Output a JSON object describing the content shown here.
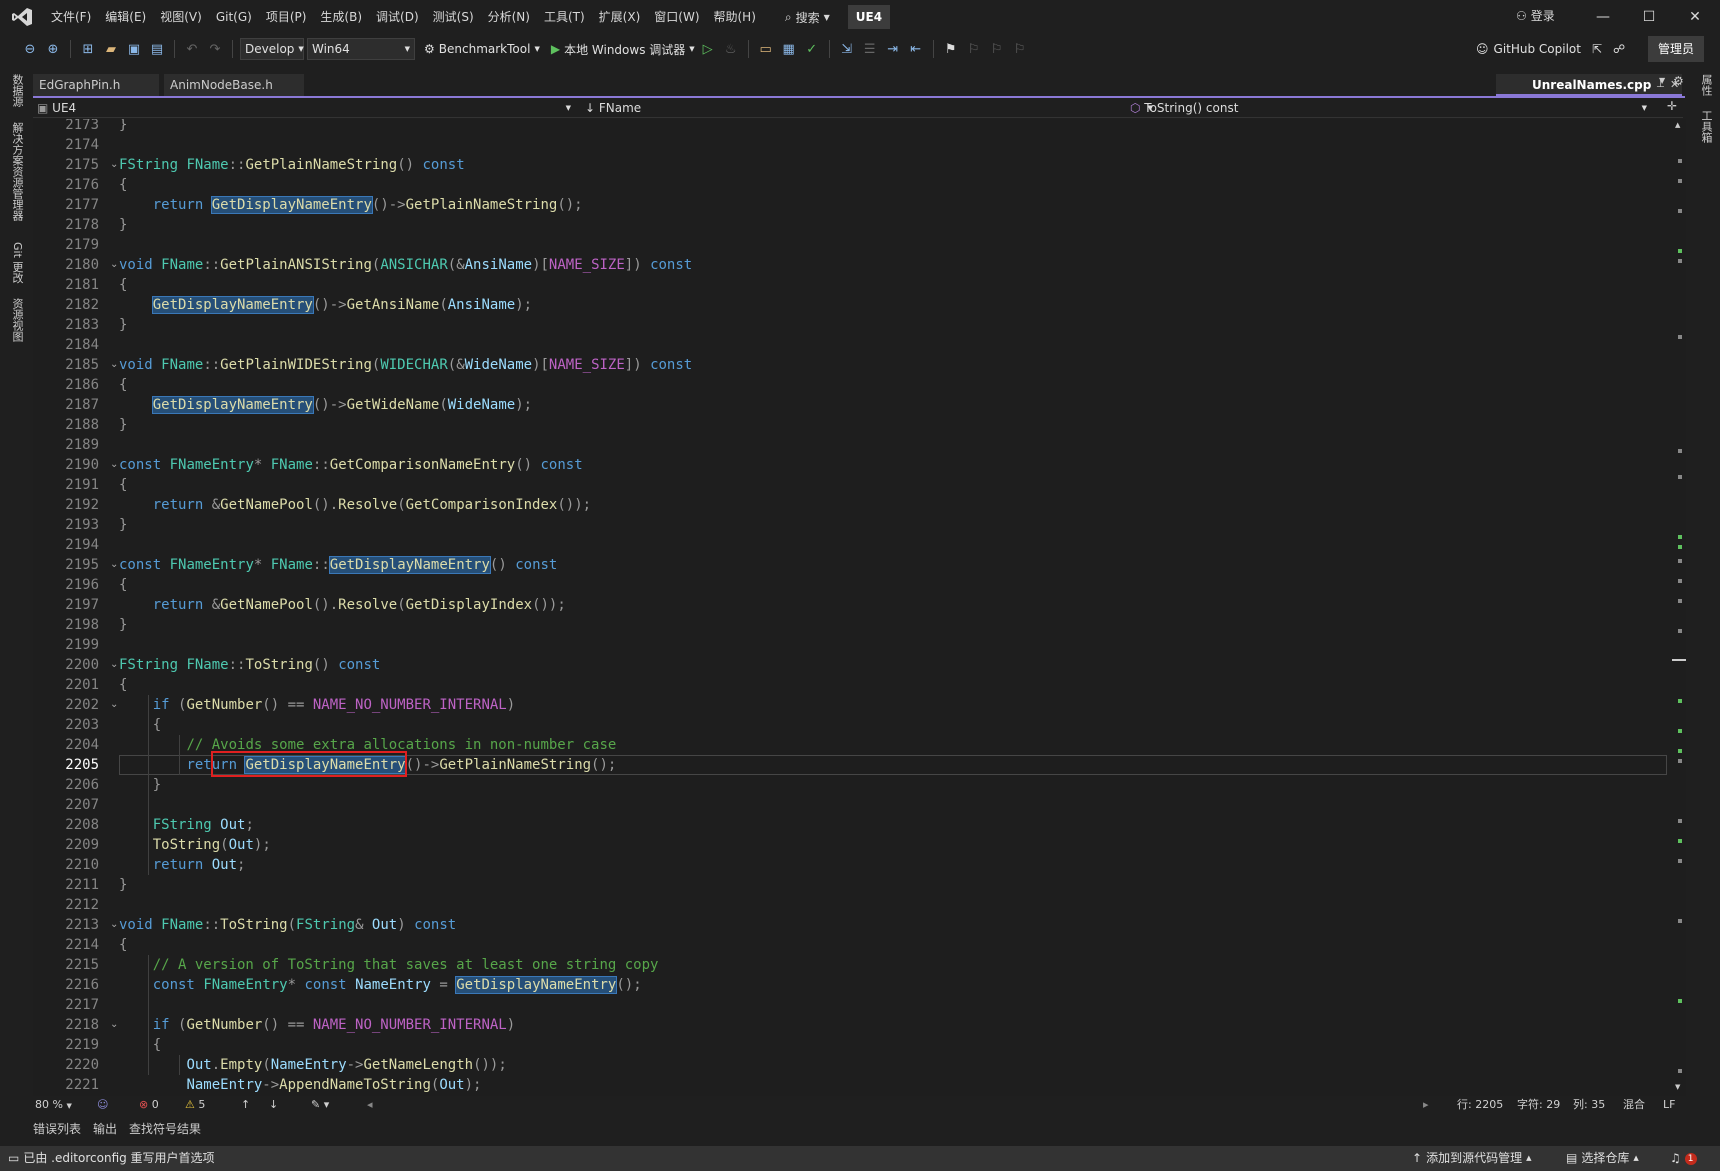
{
  "menubar": {
    "items": [
      "文件(F)",
      "编辑(E)",
      "视图(V)",
      "Git(G)",
      "项目(P)",
      "生成(B)",
      "调试(D)",
      "测试(S)",
      "分析(N)",
      "工具(T)",
      "扩展(X)",
      "窗口(W)",
      "帮助(H)"
    ],
    "search_label": "搜索",
    "solution_name": "UE4",
    "signin_label": "登录"
  },
  "toolbar": {
    "configuration": "Develop",
    "platform": "Win64",
    "startup_project": "BenchmarkTool",
    "debugger_label": "本地 Windows 调试器",
    "copilot_label": "GitHub Copilot",
    "admin_label": "管理员"
  },
  "left_tool_tabs": [
    "数据源",
    "解决方案资源管理器",
    "Git 更改",
    "资源视图"
  ],
  "right_tool_tabs": [
    "属性",
    "工具箱"
  ],
  "doc_tabs": {
    "inactive": [
      "EdGraphPin.h",
      "AnimNodeBase.h"
    ],
    "active": "UnrealNames.cpp"
  },
  "navbar": {
    "project": "UE4",
    "scope": "FName",
    "member": "ToString() const"
  },
  "editor": {
    "current_line": 2205,
    "first_line": 2173,
    "lines": [
      [
        [
          "p",
          "}"
        ]
      ],
      [],
      [
        [
          "t",
          "FString"
        ],
        [
          "p",
          " "
        ],
        [
          "t",
          "FName"
        ],
        [
          "p",
          "::"
        ],
        [
          "f",
          "GetPlainNameString"
        ],
        [
          "p",
          "() "
        ],
        [
          "k",
          "const"
        ]
      ],
      [
        [
          "p",
          "{"
        ]
      ],
      [
        [
          "p",
          "    "
        ],
        [
          "k",
          "return"
        ],
        [
          "p",
          " "
        ],
        [
          "hl",
          "GetDisplayNameEntry"
        ],
        [
          "p",
          "()->"
        ],
        [
          "f",
          "GetPlainNameString"
        ],
        [
          "p",
          "();"
        ]
      ],
      [
        [
          "p",
          "}"
        ]
      ],
      [],
      [
        [
          "k",
          "void"
        ],
        [
          "p",
          " "
        ],
        [
          "t",
          "FName"
        ],
        [
          "p",
          "::"
        ],
        [
          "f",
          "GetPlainANSIString"
        ],
        [
          "p",
          "("
        ],
        [
          "t",
          "ANSICHAR"
        ],
        [
          "p",
          "(&"
        ],
        [
          "v",
          "AnsiName"
        ],
        [
          "p",
          ")["
        ],
        [
          "m",
          "NAME_SIZE"
        ],
        [
          "p",
          "]) "
        ],
        [
          "k",
          "const"
        ]
      ],
      [
        [
          "p",
          "{"
        ]
      ],
      [
        [
          "p",
          "    "
        ],
        [
          "hl",
          "GetDisplayNameEntry"
        ],
        [
          "p",
          "()->"
        ],
        [
          "f",
          "GetAnsiName"
        ],
        [
          "p",
          "("
        ],
        [
          "v",
          "AnsiName"
        ],
        [
          "p",
          ");"
        ]
      ],
      [
        [
          "p",
          "}"
        ]
      ],
      [],
      [
        [
          "k",
          "void"
        ],
        [
          "p",
          " "
        ],
        [
          "t",
          "FName"
        ],
        [
          "p",
          "::"
        ],
        [
          "f",
          "GetPlainWIDEString"
        ],
        [
          "p",
          "("
        ],
        [
          "t",
          "WIDECHAR"
        ],
        [
          "p",
          "(&"
        ],
        [
          "v",
          "WideName"
        ],
        [
          "p",
          ")["
        ],
        [
          "m",
          "NAME_SIZE"
        ],
        [
          "p",
          "]) "
        ],
        [
          "k",
          "const"
        ]
      ],
      [
        [
          "p",
          "{"
        ]
      ],
      [
        [
          "p",
          "    "
        ],
        [
          "hl",
          "GetDisplayNameEntry"
        ],
        [
          "p",
          "()->"
        ],
        [
          "f",
          "GetWideName"
        ],
        [
          "p",
          "("
        ],
        [
          "v",
          "WideName"
        ],
        [
          "p",
          ");"
        ]
      ],
      [
        [
          "p",
          "}"
        ]
      ],
      [],
      [
        [
          "k",
          "const"
        ],
        [
          "p",
          " "
        ],
        [
          "t",
          "FNameEntry"
        ],
        [
          "p",
          "* "
        ],
        [
          "t",
          "FName"
        ],
        [
          "p",
          "::"
        ],
        [
          "f",
          "GetComparisonNameEntry"
        ],
        [
          "p",
          "() "
        ],
        [
          "k",
          "const"
        ]
      ],
      [
        [
          "p",
          "{"
        ]
      ],
      [
        [
          "p",
          "    "
        ],
        [
          "k",
          "return"
        ],
        [
          "p",
          " &"
        ],
        [
          "f",
          "GetNamePool"
        ],
        [
          "p",
          "()."
        ],
        [
          "f",
          "Resolve"
        ],
        [
          "p",
          "("
        ],
        [
          "f",
          "GetComparisonIndex"
        ],
        [
          "p",
          "());"
        ]
      ],
      [
        [
          "p",
          "}"
        ]
      ],
      [],
      [
        [
          "k",
          "const"
        ],
        [
          "p",
          " "
        ],
        [
          "t",
          "FNameEntry"
        ],
        [
          "p",
          "* "
        ],
        [
          "t",
          "FName"
        ],
        [
          "p",
          "::"
        ],
        [
          "hl",
          "GetDisplayNameEntry"
        ],
        [
          "p",
          "() "
        ],
        [
          "k",
          "const"
        ]
      ],
      [
        [
          "p",
          "{"
        ]
      ],
      [
        [
          "p",
          "    "
        ],
        [
          "k",
          "return"
        ],
        [
          "p",
          " &"
        ],
        [
          "f",
          "GetNamePool"
        ],
        [
          "p",
          "()."
        ],
        [
          "f",
          "Resolve"
        ],
        [
          "p",
          "("
        ],
        [
          "f",
          "GetDisplayIndex"
        ],
        [
          "p",
          "());"
        ]
      ],
      [
        [
          "p",
          "}"
        ]
      ],
      [],
      [
        [
          "t",
          "FString"
        ],
        [
          "p",
          " "
        ],
        [
          "t",
          "FName"
        ],
        [
          "p",
          "::"
        ],
        [
          "f",
          "ToString"
        ],
        [
          "p",
          "() "
        ],
        [
          "k",
          "const"
        ]
      ],
      [
        [
          "p",
          "{"
        ]
      ],
      [
        [
          "p",
          "    "
        ],
        [
          "k",
          "if"
        ],
        [
          "p",
          " ("
        ],
        [
          "f",
          "GetNumber"
        ],
        [
          "p",
          "() == "
        ],
        [
          "m",
          "NAME_NO_NUMBER_INTERNAL"
        ],
        [
          "p",
          ")"
        ]
      ],
      [
        [
          "p",
          "    {"
        ]
      ],
      [
        [
          "p",
          "        "
        ],
        [
          "c",
          "// Avoids some extra allocations in non-number case"
        ]
      ],
      [
        [
          "p",
          "        "
        ],
        [
          "k",
          "return"
        ],
        [
          "p",
          " "
        ],
        [
          "hl",
          "GetDisplayNameEntry"
        ],
        [
          "p",
          "()->"
        ],
        [
          "f",
          "GetPlainNameString"
        ],
        [
          "p",
          "();"
        ]
      ],
      [
        [
          "p",
          "    }"
        ]
      ],
      [],
      [
        [
          "p",
          "    "
        ],
        [
          "t",
          "FString"
        ],
        [
          "p",
          " "
        ],
        [
          "v",
          "Out"
        ],
        [
          "p",
          ";"
        ]
      ],
      [
        [
          "p",
          "    "
        ],
        [
          "f",
          "ToString"
        ],
        [
          "p",
          "("
        ],
        [
          "v",
          "Out"
        ],
        [
          "p",
          ");"
        ]
      ],
      [
        [
          "p",
          "    "
        ],
        [
          "k",
          "return"
        ],
        [
          "p",
          " "
        ],
        [
          "v",
          "Out"
        ],
        [
          "p",
          ";"
        ]
      ],
      [
        [
          "p",
          "}"
        ]
      ],
      [],
      [
        [
          "k",
          "void"
        ],
        [
          "p",
          " "
        ],
        [
          "t",
          "FName"
        ],
        [
          "p",
          "::"
        ],
        [
          "f",
          "ToString"
        ],
        [
          "p",
          "("
        ],
        [
          "t",
          "FString"
        ],
        [
          "p",
          "& "
        ],
        [
          "v",
          "Out"
        ],
        [
          "p",
          ") "
        ],
        [
          "k",
          "const"
        ]
      ],
      [
        [
          "p",
          "{"
        ]
      ],
      [
        [
          "p",
          "    "
        ],
        [
          "c",
          "// A version of ToString that saves at least one string copy"
        ]
      ],
      [
        [
          "p",
          "    "
        ],
        [
          "k",
          "const"
        ],
        [
          "p",
          " "
        ],
        [
          "t",
          "FNameEntry"
        ],
        [
          "p",
          "* "
        ],
        [
          "k",
          "const"
        ],
        [
          "p",
          " "
        ],
        [
          "v",
          "NameEntry"
        ],
        [
          "p",
          " = "
        ],
        [
          "hl",
          "GetDisplayNameEntry"
        ],
        [
          "p",
          "();"
        ]
      ],
      [],
      [
        [
          "p",
          "    "
        ],
        [
          "k",
          "if"
        ],
        [
          "p",
          " ("
        ],
        [
          "f",
          "GetNumber"
        ],
        [
          "p",
          "() == "
        ],
        [
          "m",
          "NAME_NO_NUMBER_INTERNAL"
        ],
        [
          "p",
          ")"
        ]
      ],
      [
        [
          "p",
          "    {"
        ]
      ],
      [
        [
          "p",
          "        "
        ],
        [
          "v",
          "Out"
        ],
        [
          "p",
          "."
        ],
        [
          "f",
          "Empty"
        ],
        [
          "p",
          "("
        ],
        [
          "v",
          "NameEntry"
        ],
        [
          "p",
          "->"
        ],
        [
          "f",
          "GetNameLength"
        ],
        [
          "p",
          "());"
        ]
      ],
      [
        [
          "p",
          "        "
        ],
        [
          "v",
          "NameEntry"
        ],
        [
          "p",
          "->"
        ],
        [
          "f",
          "AppendNameToString"
        ],
        [
          "p",
          "("
        ],
        [
          "v",
          "Out"
        ],
        [
          "p",
          ");"
        ]
      ]
    ]
  },
  "edit_status": {
    "zoom": "80 %",
    "errors": "0",
    "warnings": "5",
    "line": "行: 2205",
    "char": "字符: 29",
    "col": "列: 35",
    "whitespace": "混合",
    "eol": "LF"
  },
  "bottom_tabs": [
    "错误列表",
    "输出",
    "查找符号结果"
  ],
  "statusbar": {
    "message": "已由 .editorconfig 重写用户首选项",
    "source_control": "添加到源代码管理",
    "repo": "选择仓库",
    "notifications": "1"
  },
  "colors": {
    "accent": "#8a78d6",
    "keyword": "#569cd6",
    "type": "#4ec9b0",
    "function": "#dcdcaa",
    "macro": "#bd63c5",
    "variable": "#9cdcfe",
    "comment": "#57a64a",
    "highlight": "#264f78"
  }
}
